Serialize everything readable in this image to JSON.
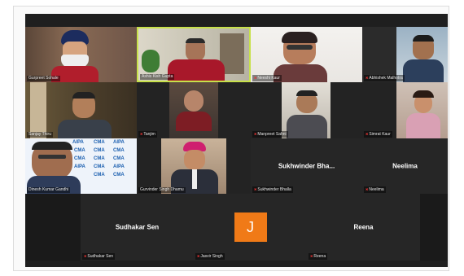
{
  "participants": [
    {
      "name": "Gurpreet Sohale"
    },
    {
      "name": "Ashis Kish Gupta"
    },
    {
      "name": "Neeshi Kaur"
    },
    {
      "name": "Abhishek Malhotra"
    },
    {
      "name": "Sanjay Thiru"
    },
    {
      "name": "Tanjim"
    },
    {
      "name": "Manpreet Sahni"
    },
    {
      "name": "Simrat Kaur"
    },
    {
      "name": "Dinesh Kumar Gandhi"
    },
    {
      "name": "Gurvinder Singh Dhamu"
    },
    {
      "name": "Sukhwinder Bha...",
      "label": "Sukhwinder Bhalla"
    },
    {
      "name": "Neelima",
      "label": "Neelima"
    },
    {
      "name": "Sudhakar Sen",
      "label": "Sudhakar Sen"
    },
    {
      "name": "J",
      "label": "Jasvir Singh"
    },
    {
      "name": "Reena",
      "label": "Reena"
    }
  ],
  "background_text": {
    "cma": "CMA",
    "aipa": "AIPA"
  },
  "colors": {
    "active_speaker_border": "#c7e14a",
    "avatar_orange": "#f07a17",
    "muted_mic": "#e33333"
  }
}
